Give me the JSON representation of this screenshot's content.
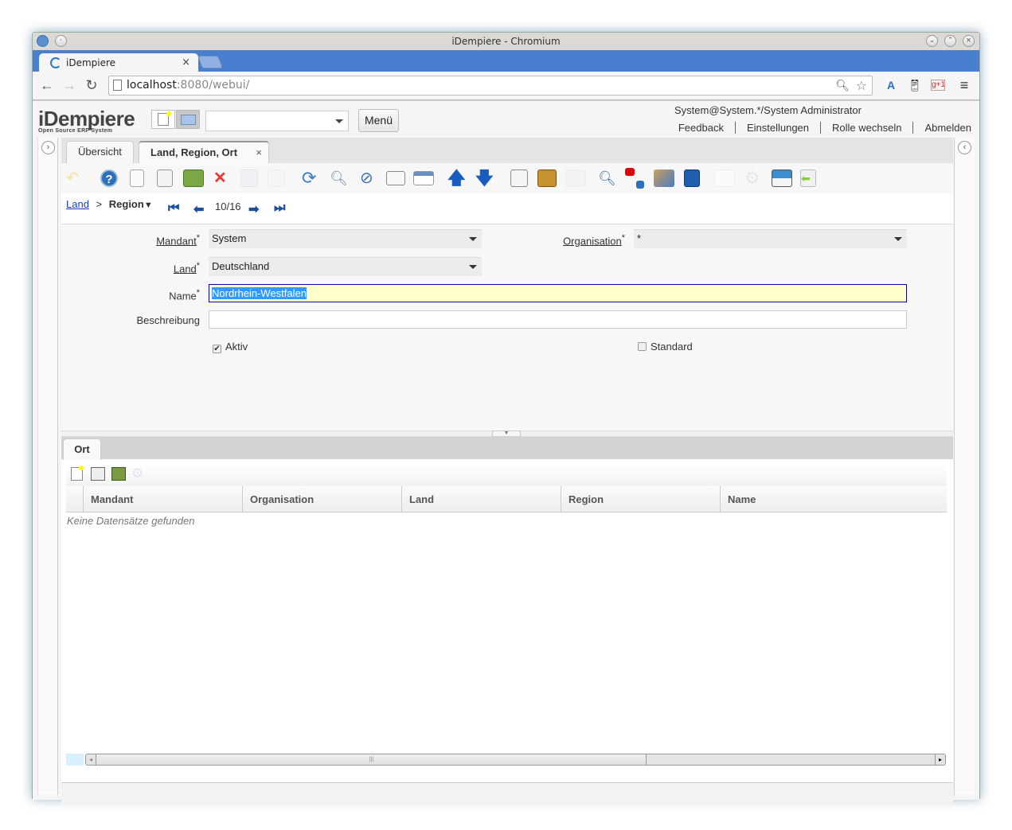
{
  "browser": {
    "window_title": "iDempiere - Chromium",
    "tab_title": "iDempiere",
    "url_host": "localhost",
    "url_rest": ":8080/webui/"
  },
  "header": {
    "logo": "iDempiere",
    "logo_sub": "Open Source ERP System",
    "search_value": "",
    "menu_label": "Menü",
    "user": "System@System.*/System Administrator",
    "links": [
      "Feedback",
      "Einstellungen",
      "Rolle wechseln",
      "Abmelden"
    ]
  },
  "window_tabs": {
    "overview": "Übersicht",
    "active": "Land, Region, Ort"
  },
  "toolbar_icons": [
    "undo-icon",
    "help-icon",
    "new-record-icon",
    "copy-record-icon",
    "delete-icon",
    "delete-selection-icon",
    "save-icon",
    "save-create-icon",
    "refresh-icon",
    "find-icon",
    "attachment-icon",
    "chat-icon",
    "grid-toggle-icon",
    "parent-record-icon",
    "detail-record-icon",
    "report-icon",
    "archive-icon",
    "print-icon",
    "zoom-across-icon",
    "active-workflows-icon",
    "requests-icon",
    "product-info-icon",
    "toggle-icon",
    "process-icon",
    "export-icon",
    "import-icon"
  ],
  "breadcrumb": {
    "parent": "Land",
    "separator": ">",
    "current": "Region",
    "record_nav": "10/16"
  },
  "form": {
    "mandant_label": "Mandant",
    "mandant_value": "System",
    "organisation_label": "Organisation",
    "organisation_value": "*",
    "land_label": "Land",
    "land_value": "Deutschland",
    "name_label": "Name",
    "name_value": "Nordrhein-Westfalen",
    "beschreibung_label": "Beschreibung",
    "beschreibung_value": "",
    "aktiv_label": "Aktiv",
    "aktiv_checked": true,
    "standard_label": "Standard",
    "standard_checked": false,
    "required_mark": "*"
  },
  "detail": {
    "tab": "Ort",
    "columns": [
      "Mandant",
      "Organisation",
      "Land",
      "Region",
      "Name"
    ],
    "rows": [],
    "empty_text": "Keine Datensätze gefunden"
  }
}
